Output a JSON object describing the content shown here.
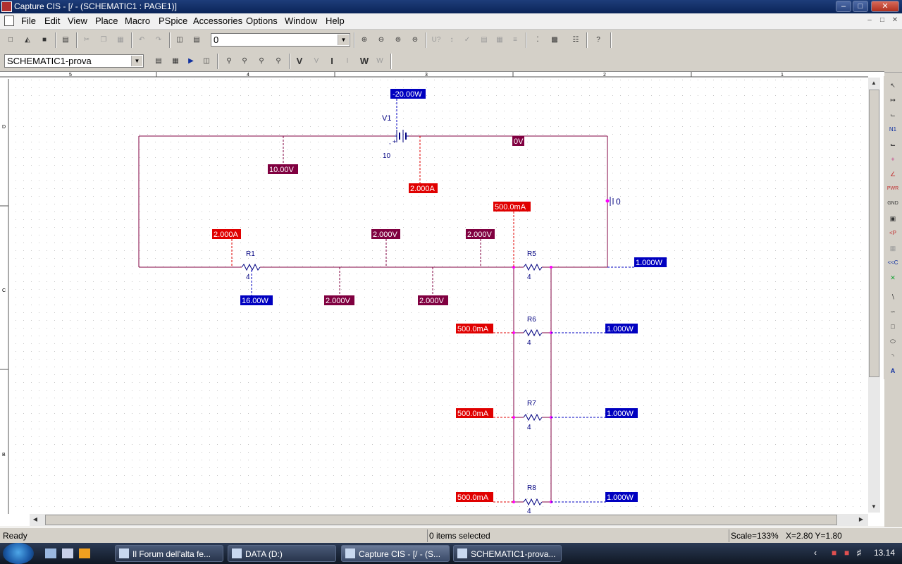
{
  "window": {
    "title": "Capture CIS - [/ - (SCHEMATIC1 : PAGE1)]"
  },
  "menu": [
    "File",
    "Edit",
    "View",
    "Place",
    "Macro",
    "PSpice",
    "Accessories",
    "Options",
    "Window",
    "Help"
  ],
  "toolbar1": {
    "part_combo": "0"
  },
  "toolbar2": {
    "design_combo": "SCHEMATIC1-prova"
  },
  "ruler": {
    "top": [
      "5",
      "4",
      "3",
      "2",
      "1"
    ],
    "left": [
      "D",
      "C",
      "B"
    ]
  },
  "schematic": {
    "parts": {
      "v1_ref": "V1",
      "v1_value": "10",
      "v1_pins": ", +",
      "r1_ref": "R1",
      "r1_value": "4",
      "r5_ref": "R5",
      "r5_value": "4",
      "r6_ref": "R6",
      "r6_value": "4",
      "r7_ref": "R7",
      "r7_value": "4",
      "r8_ref": "R8",
      "r8_value": "4",
      "ground": "0"
    },
    "markers": {
      "v1_power": "-20.00W",
      "node_top_volt": "0V",
      "node_left_volt": "10.00V",
      "v1_current": "2.000A",
      "r5_current": "500.0mA",
      "r1_current": "2.000A",
      "mid_volt_a": "2.000V",
      "mid_volt_b": "2.000V",
      "r5_power": "1.000W",
      "r1_power": "16.00W",
      "low_volt_a": "2.000V",
      "low_volt_b": "2.000V",
      "r6_current": "500.0mA",
      "r6_power": "1.000W",
      "r7_current": "500.0mA",
      "r7_power": "1.000W",
      "r8_current": "500.0mA",
      "r8_power": "1.000W"
    },
    "colors": {
      "wire": "#800040",
      "power": "#0000c0",
      "voltage": "#800040",
      "current": "#e00000",
      "pin": "#ff00ff"
    }
  },
  "status": {
    "left": "Ready",
    "selection": "0 items selected",
    "scale": "Scale=133%",
    "coords": "X=2.80  Y=1.80"
  },
  "taskbar": {
    "tasks": [
      "Il Forum dell'alta fe...",
      "DATA (D:)",
      "Capture CIS - [/ - (S...",
      "SCHEMATIC1-prova..."
    ],
    "clock": "13.14"
  }
}
